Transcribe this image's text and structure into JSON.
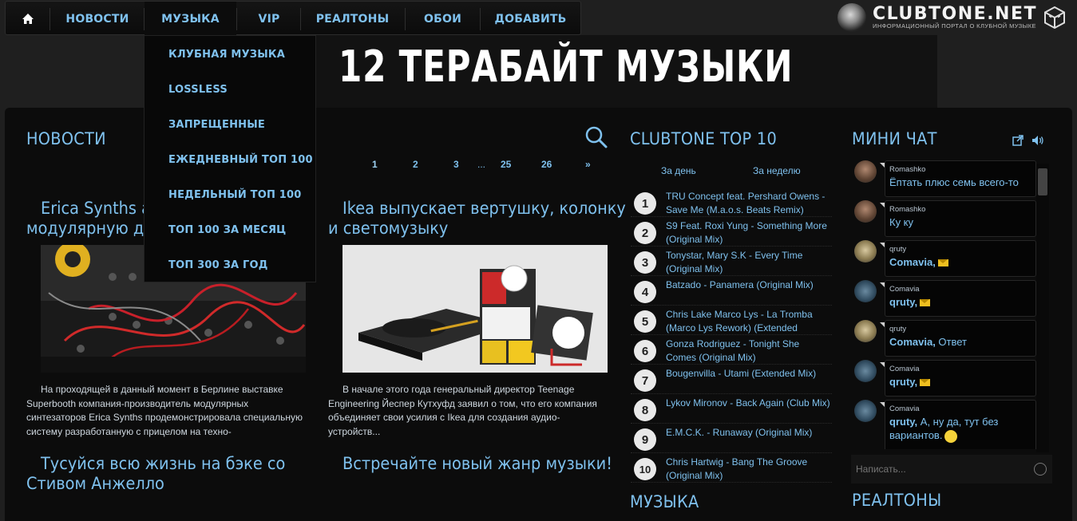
{
  "nav": {
    "items": [
      "НОВОСТИ",
      "МУЗЫКА",
      "VIP",
      "РЕАЛТОНЫ",
      "ОБОИ",
      "ДОБАВИТЬ"
    ]
  },
  "dropdown": {
    "items": [
      "КЛУБНАЯ МУЗЫКА",
      "LOSSLESS",
      "ЗАПРЕЩЕННЫЕ",
      "ЕЖЕДНЕВНЫЙ ТОП 100",
      "НЕДЕЛЬНЫЙ ТОП 100",
      "ТОП 100 ЗА МЕСЯЦ",
      "ТОП 300 ЗА ГОД"
    ]
  },
  "logo": {
    "name": "CLUBTONE.NET",
    "tagline": "Информационный портал о клубной музыке"
  },
  "banner": {
    "title": "12 ТЕРАБАЙТ МУЗЫКИ"
  },
  "news": {
    "title": "НОВОСТИ",
    "pagination": [
      "1",
      "2",
      "3",
      "...",
      "25",
      "26",
      "»"
    ],
    "articles": [
      {
        "title_line1": "Erica Synths анонсировала",
        "title_line2": "модулярную драм-машину",
        "text": "На проходящей в данный момент в Берлине выставке Superbooth компания-производитель модулярных синтезаторов Erica Synths продемонстрировала специальную систему разработанную с прицелом на техно-"
      },
      {
        "title_line1": "Ikea выпускает вертушку, колонку",
        "title_line2": "и светомузыку",
        "text": "В начале этого года генеральный директор Teenage Engineering Йеспер Кутхуфд заявил о том, что его компания объединяет свои усилия с Ikea для создания аудио-устройств..."
      },
      {
        "title_line1": "Тусуйся всю жизнь на бэке со",
        "title_line2": "Стивом Анжелло"
      },
      {
        "title_line1": "Встречайте новый жанр музыки!",
        "title_line2": ""
      }
    ]
  },
  "top10": {
    "title": "CLUBTONE TOP 10",
    "tabs": [
      "За день",
      "За неделю"
    ],
    "items": [
      {
        "n": "1",
        "line1": "TRU Concept feat. Pershard Owens -",
        "line2": "Save Me (M.a.o.s. Beats Remix)"
      },
      {
        "n": "2",
        "line1": "S9 Feat. Roxi Yung - Something More",
        "line2": "(Original Mix)"
      },
      {
        "n": "3",
        "line1": "Tonystar, Mary S.K - Every Time",
        "line2": "(Original Mix)"
      },
      {
        "n": "4",
        "line1": "Batzado - Panamera (Original Mix)",
        "line2": ""
      },
      {
        "n": "5",
        "line1": "Chris Lake Marco Lys - La Tromba",
        "line2": "(Marco Lys Rework) (Extended"
      },
      {
        "n": "6",
        "line1": "Gonza Rodriguez - Tonight She",
        "line2": "Comes (Original Mix)"
      },
      {
        "n": "7",
        "line1": "Bougenvilla - Utami (Extended Mix)",
        "line2": ""
      },
      {
        "n": "8",
        "line1": "Lykov Mironov - Back Again (Club Mix)",
        "line2": ""
      },
      {
        "n": "9",
        "line1": "E.M.C.K. - Runaway (Original Mix)",
        "line2": ""
      },
      {
        "n": "10",
        "line1": "Chris Hartwig - Bang The Groove",
        "line2": "(Original Mix)"
      }
    ]
  },
  "music": {
    "title": "МУЗЫКА"
  },
  "chat": {
    "title": "МИНИ ЧАТ",
    "placeholder": "Написать...",
    "messages": [
      {
        "user": "Romashko",
        "bold": "",
        "text": "Ёптать плюс семь всего-то",
        "icon": ""
      },
      {
        "user": "Romashko",
        "bold": "",
        "text": "Ку ку",
        "icon": ""
      },
      {
        "user": "qruty",
        "bold": "Comavia,",
        "text": "",
        "icon": "envelope-icon"
      },
      {
        "user": "Comavia",
        "bold": "qruty,",
        "text": "",
        "icon": "envelope-icon"
      },
      {
        "user": "qruty",
        "bold": "Comavia,",
        "text": " Ответ",
        "icon": ""
      },
      {
        "user": "Comavia",
        "bold": "qruty,",
        "text": "",
        "icon": "envelope-icon"
      },
      {
        "user": "Comavia",
        "bold": "qruty,",
        "text": " А, ну да, тут без вариантов.",
        "icon": "smiley-icon"
      }
    ]
  },
  "ringtones": {
    "title": "РЕАЛТОНЫ"
  },
  "colors": {
    "accent": "#7fc1ee",
    "background": "#0c0c0c"
  }
}
